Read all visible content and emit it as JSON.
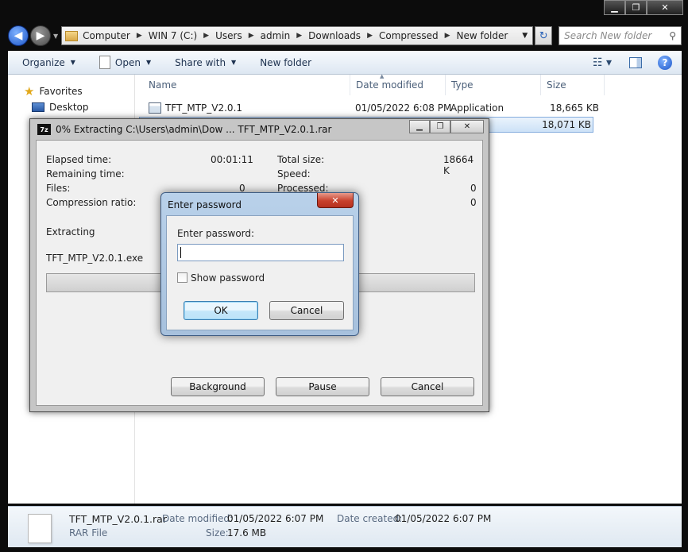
{
  "explorer": {
    "window_controls": {
      "minimize": "▁",
      "maximize": "❐",
      "close": "✕"
    },
    "address": {
      "crumbs": [
        "Computer",
        "WIN 7 (C:)",
        "Users",
        "admin",
        "Downloads",
        "Compressed",
        "New folder"
      ],
      "search_placeholder": "Search New folder"
    },
    "toolbar": {
      "organize": "Organize",
      "open": "Open",
      "share_with": "Share with",
      "new_folder": "New folder"
    },
    "nav": {
      "favorites": "Favorites",
      "desktop": "Desktop"
    },
    "columns": {
      "name": "Name",
      "date_modified": "Date modified",
      "type": "Type",
      "size": "Size"
    },
    "files": [
      {
        "name": "TFT_MTP_V2.0.1",
        "date": "01/05/2022 6:08 PM",
        "type": "Application",
        "size": "18,665 KB"
      },
      {
        "name": "",
        "date": "",
        "type": "",
        "size": "18,071 KB"
      }
    ],
    "status": {
      "file_name": "TFT_MTP_V2.0.1.rar",
      "file_type": "RAR File",
      "date_modified_label": "Date modified:",
      "date_modified": "01/05/2022 6:07 PM",
      "size_label": "Size:",
      "size": "17.6 MB",
      "date_created_label": "Date created:",
      "date_created": "01/05/2022 6:07 PM"
    }
  },
  "extract_dialog": {
    "logo": "7z",
    "title": "0% Extracting C:\\Users\\admin\\Dow ... TFT_MTP_V2.0.1.rar",
    "elapsed_label": "Elapsed time:",
    "elapsed": "00:01:11",
    "remaining_label": "Remaining time:",
    "files_label": "Files:",
    "files": "0",
    "ratio_label": "Compression ratio:",
    "total_size_label": "Total size:",
    "total_size": "18664 K",
    "speed_label": "Speed:",
    "processed_label": "Processed:",
    "processed": "0",
    "extra_value": "0",
    "status": "Extracting",
    "current_file": "TFT_MTP_V2.0.1.exe",
    "progress_percent": 0,
    "buttons": {
      "background": "Background",
      "pause": "Pause",
      "cancel": "Cancel"
    }
  },
  "password_dialog": {
    "title": "Enter password",
    "label": "Enter password:",
    "value": "",
    "show_password": "Show password",
    "ok": "OK",
    "cancel": "Cancel"
  }
}
